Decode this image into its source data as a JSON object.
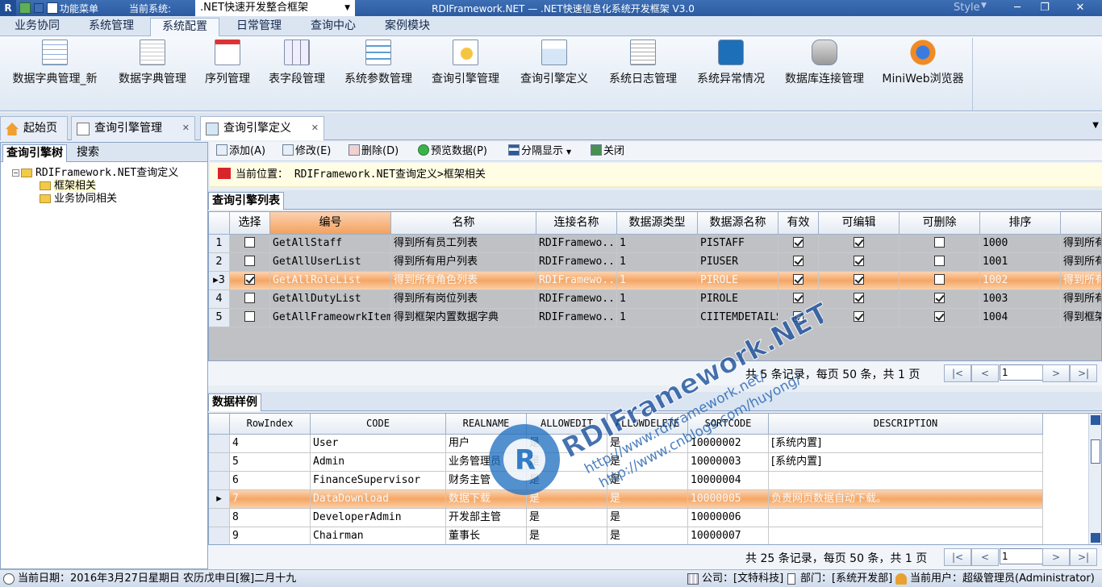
{
  "titlebar": {
    "quick_menu": "功能菜单",
    "current_system_label": "当前系统:",
    "current_system_value": ".NET快速开发整合框架",
    "title": "RDIFramework.NET — .NET快速信息化系统开发框架 V3.0",
    "style_label": "Style"
  },
  "menu": [
    "业务协同",
    "系统管理",
    "系统配置",
    "日常管理",
    "查询中心",
    "案例模块"
  ],
  "ribbon": [
    "数据字典管理_新",
    "数据字典管理",
    "序列管理",
    "表字段管理",
    "系统参数管理",
    "查询引擎管理",
    "查询引擎定义",
    "系统日志管理",
    "系统异常情况",
    "数据库连接管理",
    "MiniWeb浏览器"
  ],
  "doc_tabs": [
    "起始页",
    "查询引擎管理",
    "查询引擎定义"
  ],
  "left": {
    "tabs": [
      "查询引擎树",
      "搜索"
    ],
    "tree_root": "RDIFramework.NET查询定义",
    "tree_children": [
      "框架相关",
      "业务协同相关"
    ]
  },
  "toolbar": {
    "add": "添加(A)",
    "edit": "修改(E)",
    "delete": "删除(D)",
    "preview": "预览数据(P)",
    "split": "分隔显示",
    "close": "关闭"
  },
  "location": "当前位置： RDIFramework.NET查询定义>框架相关",
  "grid1": {
    "section": "查询引擎列表",
    "headers": [
      "选择",
      "编号",
      "名称",
      "连接名称",
      "数据源类型",
      "数据源名称",
      "有效",
      "可编辑",
      "可删除",
      "排序",
      ""
    ],
    "rows": [
      {
        "idx": "1",
        "code": "GetAllStaff",
        "name": "得到所有员工列表",
        "conn": "RDIFramewo...",
        "type": "1",
        "src": "PISTAFF",
        "enabled": true,
        "editable": true,
        "deletable": false,
        "sort": "1000",
        "extra": "得到所有"
      },
      {
        "idx": "2",
        "code": "GetAllUserList",
        "name": "得到所有用户列表",
        "conn": "RDIFramewo...",
        "type": "1",
        "src": "PIUSER",
        "enabled": true,
        "editable": true,
        "deletable": false,
        "sort": "1001",
        "extra": "得到所有"
      },
      {
        "idx": "3",
        "code": "GetAllRoleList",
        "name": "得到所有角色列表",
        "conn": "RDIFramewo...",
        "type": "1",
        "src": "PIROLE",
        "enabled": true,
        "editable": true,
        "deletable": false,
        "sort": "1002",
        "extra": "得到所有"
      },
      {
        "idx": "4",
        "code": "GetAllDutyList",
        "name": "得到所有岗位列表",
        "conn": "RDIFramewo...",
        "type": "1",
        "src": "PIROLE",
        "enabled": true,
        "editable": true,
        "deletable": true,
        "sort": "1003",
        "extra": "得到所有"
      },
      {
        "idx": "5",
        "code": "GetAllFrameowrkItems",
        "name": "得到框架内置数据字典",
        "conn": "RDIFramewo...",
        "type": "1",
        "src": "CIITEMDETAILS",
        "enabled": true,
        "editable": true,
        "deletable": true,
        "sort": "1004",
        "extra": "得到框架"
      }
    ],
    "pager": "共 5 条记录，每页 50 条，共 1 页",
    "page": "1"
  },
  "grid2": {
    "section": "数据样例",
    "headers": [
      "RowIndex",
      "CODE",
      "REALNAME",
      "ALLOWEDIT",
      "ALLOWDELETE",
      "SORTCODE",
      "DESCRIPTION"
    ],
    "rows": [
      [
        "4",
        "User",
        "用户",
        "是",
        "是",
        "10000002",
        "[系统内置]"
      ],
      [
        "5",
        "Admin",
        "业务管理员",
        "是",
        "是",
        "10000003",
        "[系统内置]"
      ],
      [
        "6",
        "FinanceSupervisor",
        "财务主管",
        "是",
        "是",
        "10000004",
        ""
      ],
      [
        "7",
        "DataDownload",
        "数据下载",
        "是",
        "是",
        "10000005",
        "负责网页数据自动下载。"
      ],
      [
        "8",
        "DeveloperAdmin",
        "开发部主管",
        "是",
        "是",
        "10000006",
        ""
      ],
      [
        "9",
        "Chairman",
        "董事长",
        "是",
        "是",
        "10000007",
        ""
      ]
    ],
    "pager": "共 25 条记录，每页 50 条，共 1 页",
    "page": "1"
  },
  "status": {
    "date": "当前日期：2016年3月27日星期日 农历戊申日[猴]二月十九",
    "company": "公司：[文特科技]",
    "dept": "部门：[系统开发部]",
    "user": "当前用户：超级管理员(Administrator)"
  },
  "watermark": {
    "brand": "RDIFramework.NET",
    "url1": "http://www.rdiframework.net/",
    "url2": "http://www.cnblogs.com/huyong/"
  },
  "colors": {
    "accent": "#2c5aa0",
    "selected_row": "#f5a664",
    "location_bg": "#fffde3"
  }
}
